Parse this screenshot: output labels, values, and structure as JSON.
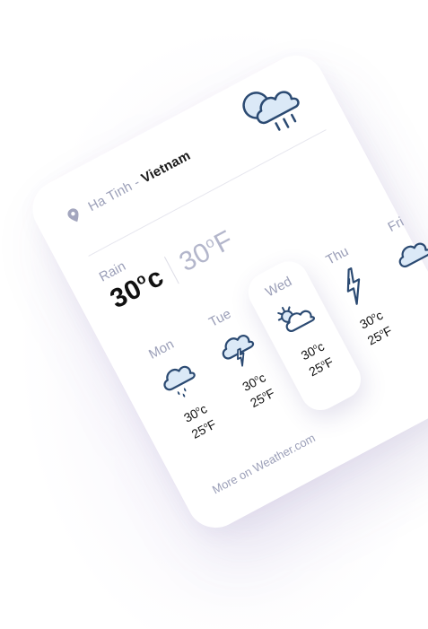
{
  "location": {
    "city": "Ha Tinh -",
    "country": "Vietnam"
  },
  "header_icon": "cloud-sun-rain-icon",
  "current": {
    "condition": "Rain",
    "temp_c": "30",
    "temp_c_unit": "c",
    "temp_f": "30",
    "temp_f_unit": "F"
  },
  "forecast": [
    {
      "day": "Mon",
      "icon": "cloud-rain-icon",
      "c": "30",
      "c_unit": "c",
      "f": "25",
      "f_unit": "F"
    },
    {
      "day": "Tue",
      "icon": "cloud-lightning-icon",
      "c": "30",
      "c_unit": "c",
      "f": "25",
      "f_unit": "F"
    },
    {
      "day": "Wed",
      "icon": "sun-cloud-icon",
      "c": "30",
      "c_unit": "c",
      "f": "25",
      "f_unit": "F"
    },
    {
      "day": "Thu",
      "icon": "lightning-icon",
      "c": "30",
      "c_unit": "c",
      "f": "25",
      "f_unit": "F"
    },
    {
      "day": "Fri",
      "icon": "cloud-icon",
      "c": "",
      "c_unit": "",
      "f": "",
      "f_unit": ""
    }
  ],
  "more_link": "More on Weather.com",
  "colors": {
    "icon_stroke": "#2b4a72",
    "icon_fill": "#dbe9f7",
    "muted": "#9b9fb8"
  }
}
